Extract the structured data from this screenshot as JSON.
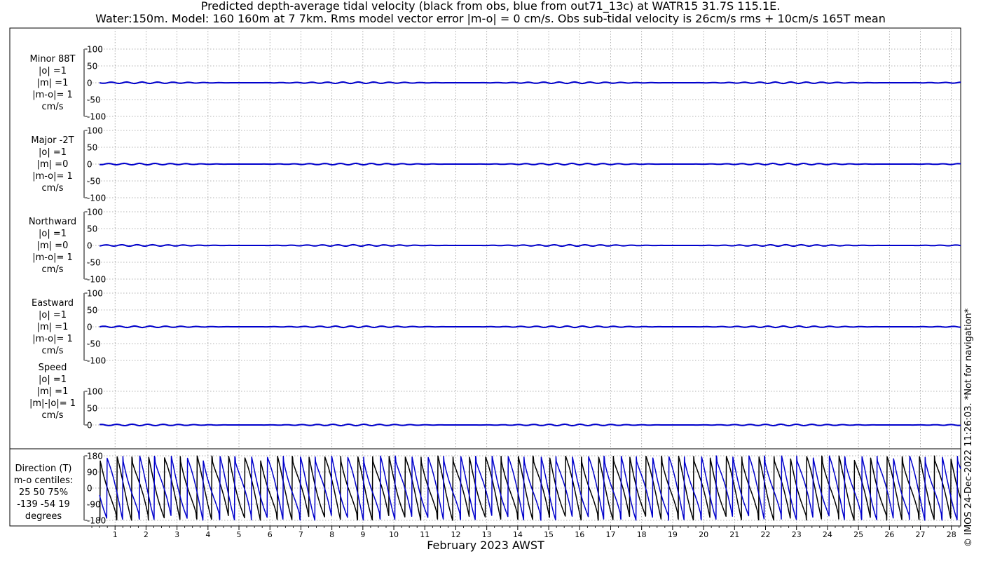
{
  "title_line1": "Predicted depth-average tidal velocity (black from obs, blue from out71_13c) at WATR15 31.7S 115.1E.",
  "title_line2": "Water:150m. Model: 160 160m at 7 7km. Rms model vector error |m-o| = 0 cm/s. Obs sub-tidal velocity is 26cm/s rms + 10cm/s 165T mean",
  "credit": "© IMOS 24-Dec-2022 11:26:03.  *Not for navigation*",
  "colors": {
    "obs": "#000000",
    "model": "#0000cc"
  },
  "chart_data": {
    "type": "line",
    "xlabel": "February 2023 AWST",
    "x_ticks": [
      "1",
      "2",
      "3",
      "4",
      "5",
      "6",
      "7",
      "8",
      "9",
      "10",
      "11",
      "12",
      "13",
      "14",
      "15",
      "16",
      "17",
      "18",
      "19",
      "20",
      "21",
      "22",
      "23",
      "24",
      "25",
      "26",
      "27",
      "28"
    ],
    "xlim": [
      0.0,
      28.3
    ],
    "grid": true,
    "series_legend": [
      "black from obs",
      "blue from out71_13c"
    ],
    "panels": [
      {
        "id": "minor",
        "label_lines": [
          "Minor 88T",
          "|o| =1",
          "|m| =1",
          "|m-o|= 1",
          "cm/s"
        ],
        "yticks": [
          "100",
          "50",
          "0",
          "-50",
          "-100"
        ],
        "ylim": [
          -100,
          100
        ],
        "obs_level": 0,
        "model_level": 0
      },
      {
        "id": "major",
        "label_lines": [
          "Major -2T",
          "|o| =1",
          "|m| =0",
          "|m-o|= 1",
          "cm/s"
        ],
        "yticks": [
          "100",
          "50",
          "0",
          "-50",
          "-100"
        ],
        "ylim": [
          -100,
          100
        ],
        "obs_level": 0,
        "model_level": 0
      },
      {
        "id": "north",
        "label_lines": [
          "Northward",
          "|o| =1",
          "|m| =0",
          "|m-o|= 1",
          "cm/s"
        ],
        "yticks": [
          "100",
          "50",
          "0",
          "-50",
          "-100"
        ],
        "ylim": [
          -100,
          100
        ],
        "obs_level": 0,
        "model_level": 0
      },
      {
        "id": "east",
        "label_lines": [
          "Eastward",
          "|o| =1",
          "|m| =1",
          "|m-o|= 1",
          "cm/s"
        ],
        "yticks": [
          "100",
          "50",
          "0",
          "-50",
          "-100"
        ],
        "ylim": [
          -100,
          100
        ],
        "obs_level": 0,
        "model_level": 0
      },
      {
        "id": "speed",
        "label_lines": [
          "Speed",
          "|o| =1",
          "|m| =1",
          "|m|-|o|= 1",
          "cm/s"
        ],
        "yticks": [
          "100",
          "50",
          "0"
        ],
        "ylim": [
          0,
          100
        ],
        "obs_level": 0,
        "model_level": 0
      },
      {
        "id": "direction",
        "label_lines": [
          "Direction (T)",
          "m-o centiles:",
          "25  50  75%",
          "-139  -54  19",
          "degrees"
        ],
        "yticks": [
          "180",
          "90",
          "0",
          "-90",
          "-180"
        ],
        "ylim": [
          -180,
          180
        ],
        "obs_cycles_per_day": 1.93,
        "model_phase_lag_days": 0.3,
        "value_range": [
          -180,
          180
        ]
      }
    ]
  }
}
